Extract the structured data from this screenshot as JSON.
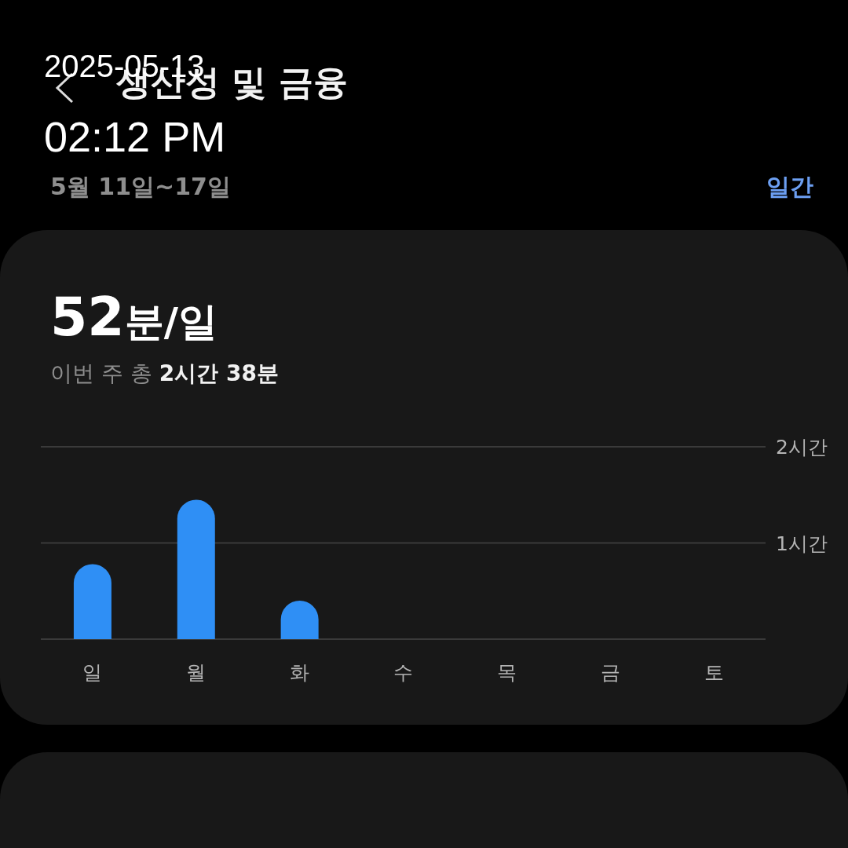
{
  "overlay": {
    "date": "2025-05-13",
    "time": "02:12 PM"
  },
  "header": {
    "title": "생산성 및 금융"
  },
  "period": {
    "range": "5월 11일~17일",
    "mode": "일간"
  },
  "summary": {
    "value": "52",
    "unit": "분/일",
    "subtitle": "이번 주 총 **2시간 38분**"
  },
  "chart_data": {
    "type": "bar",
    "categories": [
      "일",
      "월",
      "화",
      "수",
      "목",
      "금",
      "토"
    ],
    "series": [
      {
        "color": "#2f8ff5",
        "values": [
          0.78,
          1.45,
          0.4,
          0,
          0,
          0,
          0
        ]
      }
    ],
    "ylim": [
      0,
      2
    ],
    "yticks": [
      {
        "value": 1,
        "label": "1시간"
      },
      {
        "value": 2,
        "label": "2시간"
      }
    ]
  }
}
